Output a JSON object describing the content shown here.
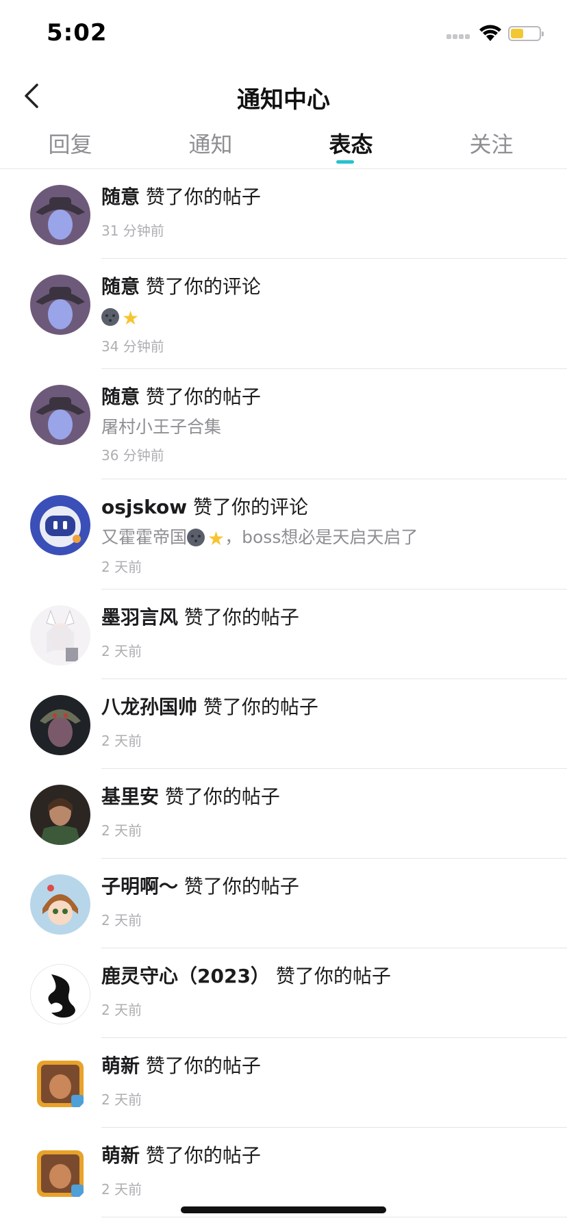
{
  "status_bar": {
    "time": "5:02"
  },
  "nav": {
    "title": "通知中心"
  },
  "tabs": [
    {
      "label": "回复"
    },
    {
      "label": "通知"
    },
    {
      "label": "表态",
      "active": true
    },
    {
      "label": "关注"
    }
  ],
  "accent_color": "#29c2cc",
  "notifications": [
    {
      "user": "随意",
      "action": "赞了你的帖子",
      "snippet": "",
      "time": "31 分钟前",
      "avatar": "wizard-avatar"
    },
    {
      "user": "随意",
      "action": "赞了你的评论",
      "snippet": "",
      "emoji": true,
      "time": "34 分钟前",
      "avatar": "wizard-avatar"
    },
    {
      "user": "随意",
      "action": "赞了你的帖子",
      "snippet": "屠村小王子合集",
      "time": "36 分钟前",
      "avatar": "wizard-avatar"
    },
    {
      "user": "osjskow",
      "action": "赞了你的评论",
      "snippet_pre": "又霍霍帝国",
      "snippet_post": "，boss想必是天启天启了",
      "emoji_inline": true,
      "time": "2 天前",
      "avatar": "robot-avatar"
    },
    {
      "user": "墨羽言风",
      "action": "赞了你的帖子",
      "snippet": "",
      "time": "2 天前",
      "avatar": "anime-fox-avatar"
    },
    {
      "user": "八龙孙国帅",
      "action": "赞了你的帖子",
      "snippet": "",
      "time": "2 天前",
      "avatar": "warrior-avatar"
    },
    {
      "user": "基里安",
      "action": "赞了你的帖子",
      "snippet": "",
      "time": "2 天前",
      "avatar": "man-avatar"
    },
    {
      "user": "子明啊～",
      "action": "赞了你的帖子",
      "snippet": "",
      "time": "2 天前",
      "avatar": "anime-girl-avatar"
    },
    {
      "user": "鹿灵守心（2023）",
      "action": "赞了你的帖子",
      "snippet": "",
      "time": "2 天前",
      "avatar": "dragon-avatar"
    },
    {
      "user": "萌新",
      "action": "赞了你的帖子",
      "snippet": "",
      "time": "2 天前",
      "avatar": "game-hero-avatar"
    },
    {
      "user": "萌新",
      "action": "赞了你的帖子",
      "snippet": "",
      "time": "2 天前",
      "avatar": "game-hero-avatar"
    }
  ]
}
